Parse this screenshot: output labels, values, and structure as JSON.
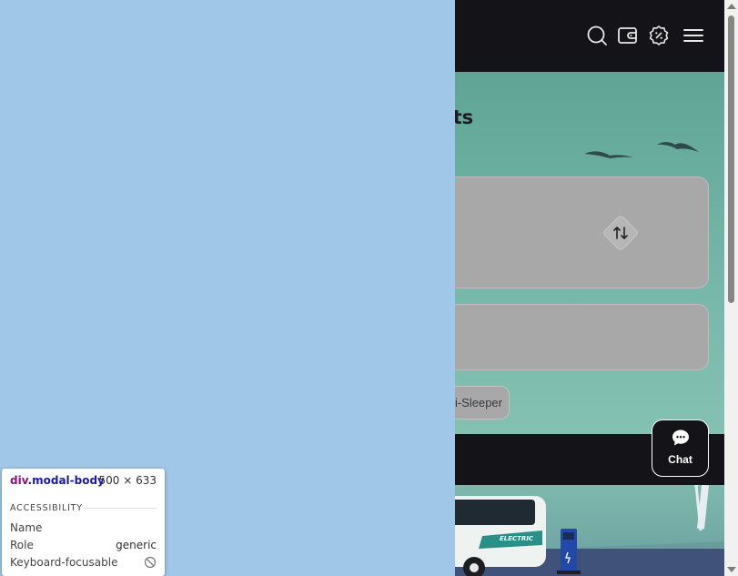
{
  "header": {
    "icons": [
      "search-icon",
      "wallet-icon",
      "discount-badge-icon",
      "menu-icon"
    ]
  },
  "hero": {
    "heading": "kets"
  },
  "chip": {
    "label": "i-Sleeper"
  },
  "bus": {
    "label": "ELECTRIC"
  },
  "chat": {
    "label": "Chat"
  },
  "inspector": {
    "tag": "div",
    "class_name": ".modal-body",
    "size": "500 × 633",
    "section": "ACCESSIBILITY",
    "rows": [
      {
        "key": "Name",
        "value": ""
      },
      {
        "key": "Role",
        "value": "generic"
      },
      {
        "key": "Keyboard-focusable",
        "value": ""
      }
    ]
  },
  "colors": {
    "header_bg": "#141317",
    "overlay": "#a0c6e8",
    "card": "#a8a8a8",
    "scene_teal": "#5fa89d"
  }
}
